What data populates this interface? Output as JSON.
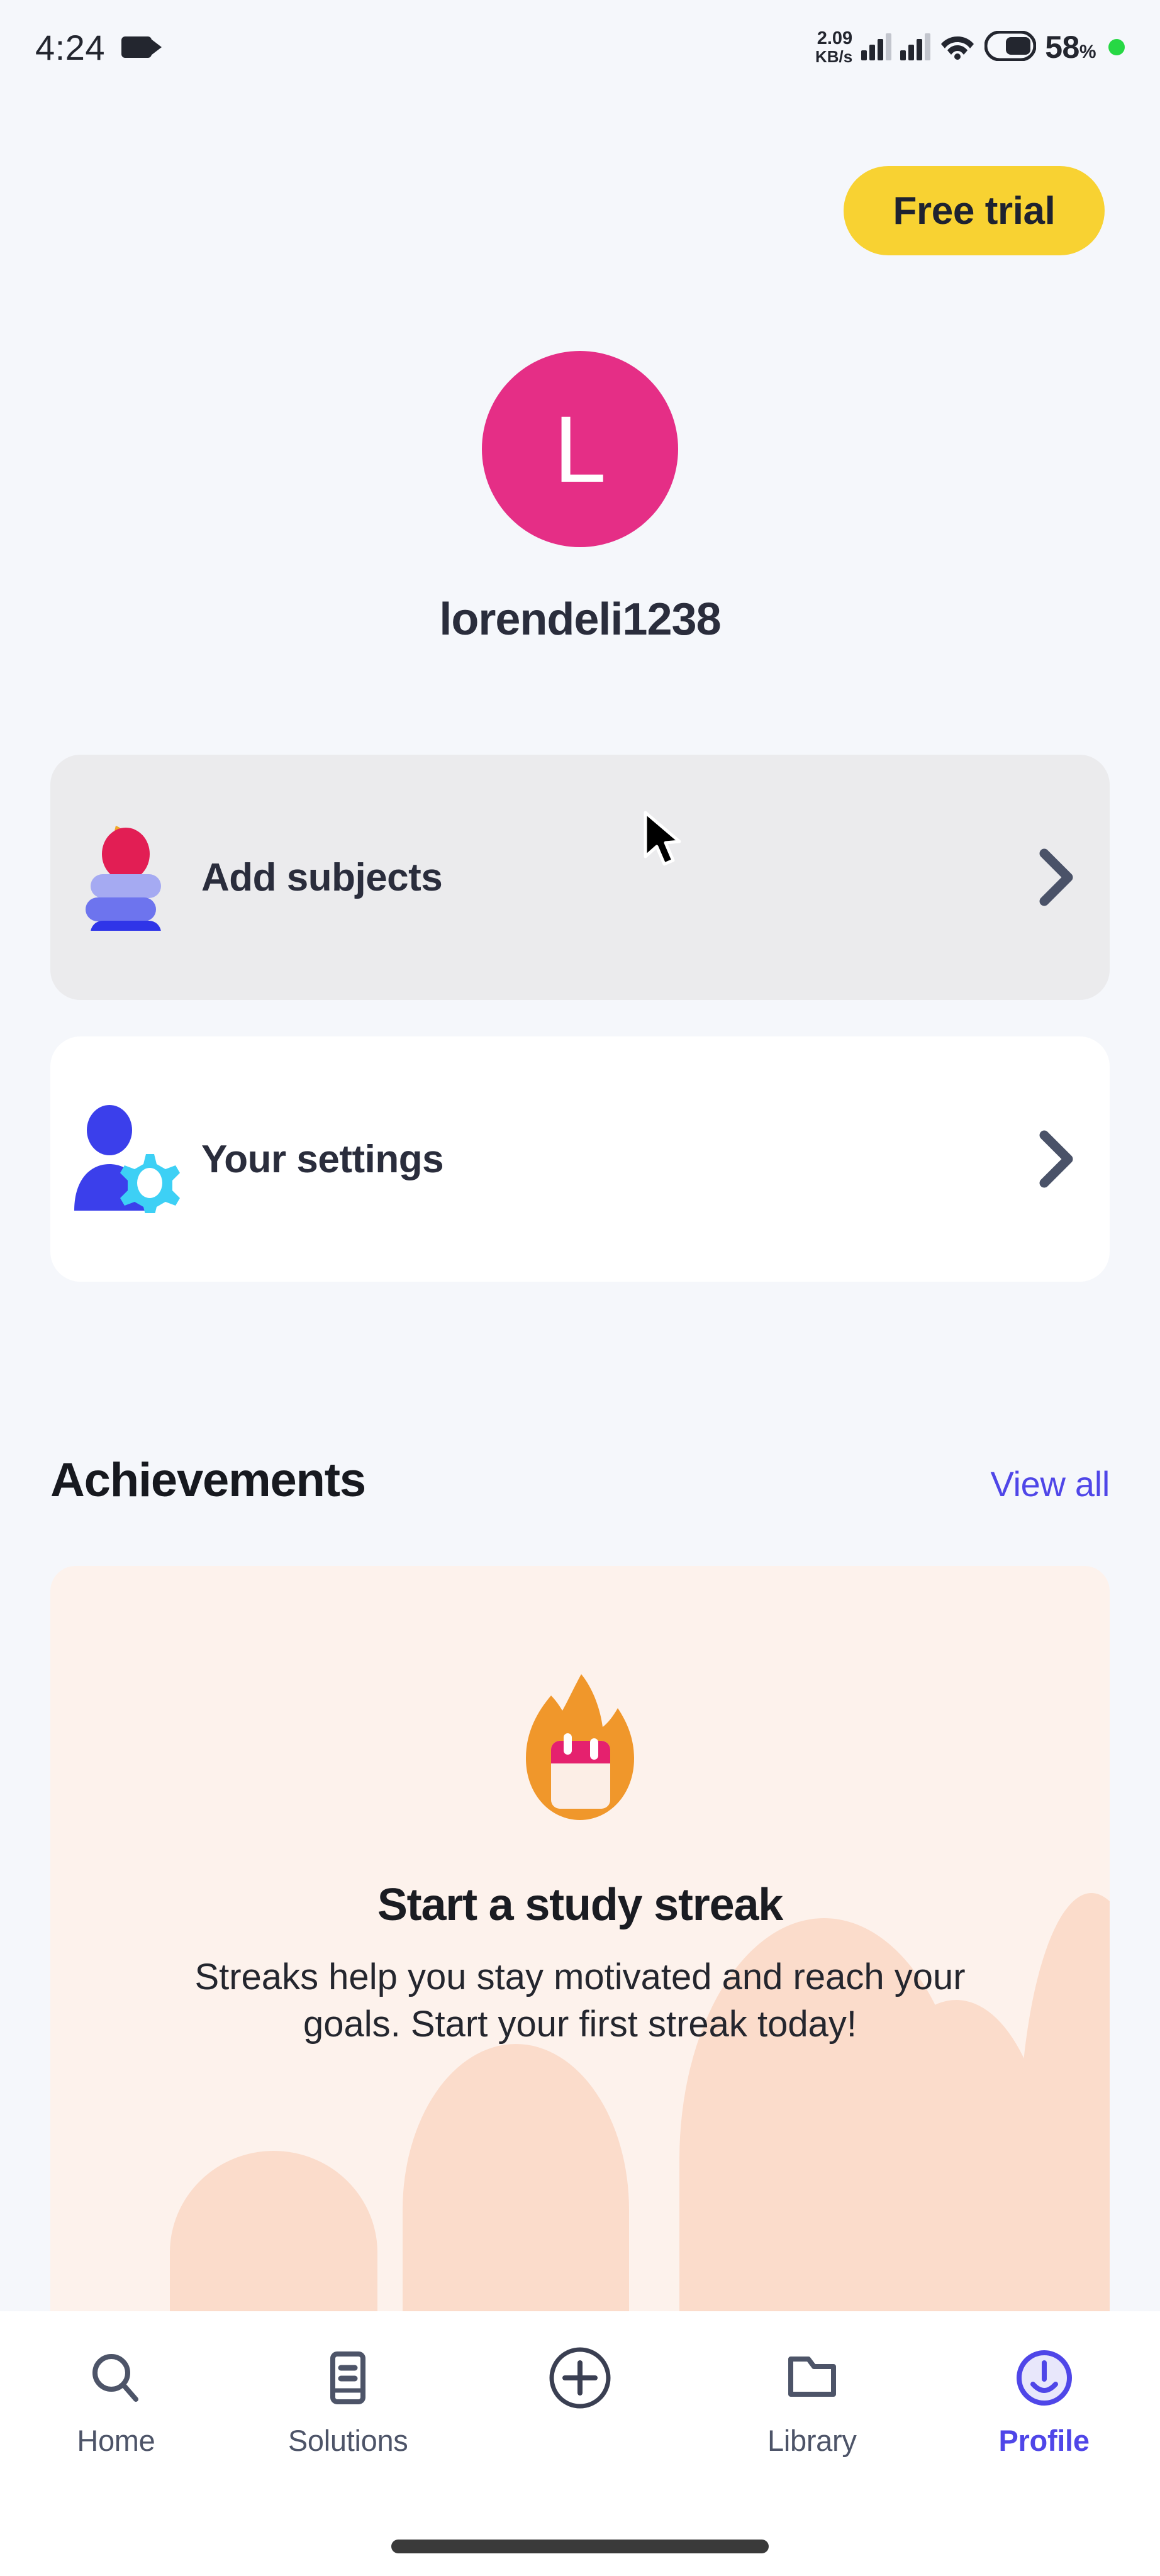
{
  "status_bar": {
    "time": "4:24",
    "recording_icon": "video-camera-icon",
    "net_speed_value": "2.09",
    "net_speed_unit": "KB/s",
    "signal_icon_1": "cellular-signal-icon",
    "signal_icon_2": "cellular-signal-icon",
    "wifi_icon": "wifi-icon",
    "battery_icon": "battery-icon",
    "battery_percent": "58",
    "battery_percent_symbol": "%",
    "status_dot": "green-recording-dot"
  },
  "header": {
    "free_trial_label": "Free trial"
  },
  "profile": {
    "avatar_initial": "L",
    "avatar_color": "#E52E86",
    "username": "lorendeli1238"
  },
  "menu": {
    "items": [
      {
        "label": "Add subjects",
        "icon": "apple-on-books-icon",
        "chevron": "chevron-right-icon",
        "state": "highlighted"
      },
      {
        "label": "Your settings",
        "icon": "person-gear-icon",
        "chevron": "chevron-right-icon",
        "state": "default"
      }
    ]
  },
  "achievements": {
    "title": "Achievements",
    "view_all_label": "View all",
    "view_all_color": "#4F46E8",
    "card": {
      "icon": "flame-calendar-streak-icon",
      "title": "Start a study streak",
      "body": "Streaks help you stay motivated and reach your goals. Start your first streak today!",
      "background_color": "#FDF2EC"
    }
  },
  "bottom_nav": {
    "active_color": "#4F46E8",
    "inactive_color": "#4D5468",
    "items": [
      {
        "label": "Home",
        "icon": "search-icon",
        "active": false
      },
      {
        "label": "Solutions",
        "icon": "document-icon",
        "active": false
      },
      {
        "label": "",
        "icon": "plus-circle-icon",
        "active": false
      },
      {
        "label": "Library",
        "icon": "folder-icon",
        "active": false
      },
      {
        "label": "Profile",
        "icon": "profile-icon",
        "active": true
      }
    ]
  },
  "cursor": {
    "icon": "mouse-pointer-icon"
  }
}
